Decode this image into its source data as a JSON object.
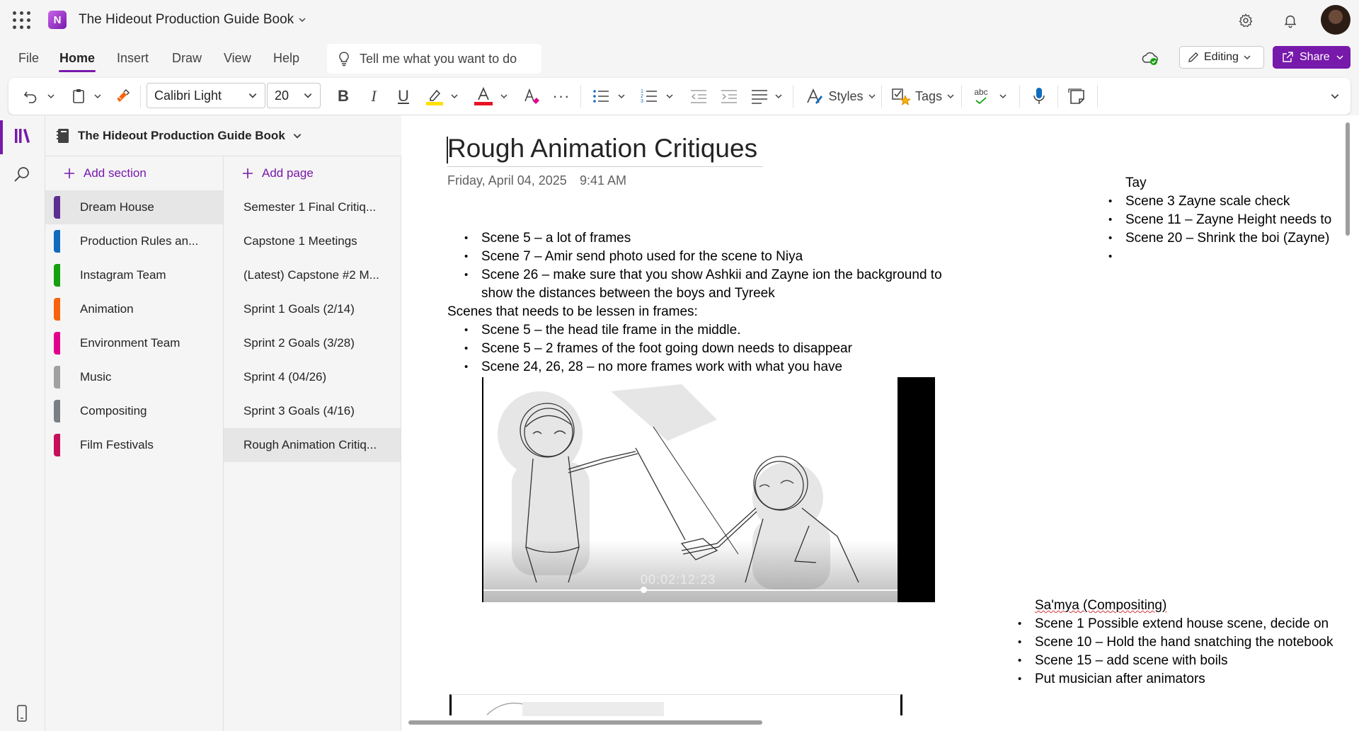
{
  "app": {
    "notebook_title": "The Hideout Production Guide Book",
    "icon_names": [
      "app-launcher-icon",
      "onenote-logo-icon",
      "settings-icon",
      "bell-icon",
      "avatar"
    ]
  },
  "menu": {
    "items": [
      "File",
      "Home",
      "Insert",
      "Draw",
      "View",
      "Help"
    ],
    "active": "Home",
    "tell_me": "Tell me what you want to do",
    "editing_label": "Editing",
    "share_label": "Share"
  },
  "ribbon": {
    "font_name": "Calibri Light",
    "font_size": "20",
    "styles_label": "Styles",
    "tags_label": "Tags",
    "spell_label": "abc"
  },
  "sidebar": {
    "notebook_name": "The Hideout Production Guide Book",
    "add_section_label": "Add section",
    "add_page_label": "Add page",
    "sections": [
      {
        "label": "Dream House",
        "color": "#5c2e91"
      },
      {
        "label": "Production Rules an...",
        "color": "#0f6cbd"
      },
      {
        "label": "Instagram Team",
        "color": "#13a10e"
      },
      {
        "label": "Animation",
        "color": "#f7630c"
      },
      {
        "label": "Environment Team",
        "color": "#e3008c"
      },
      {
        "label": "Music",
        "color": "#a0a0a0"
      },
      {
        "label": "Compositing",
        "color": "#7a7f85"
      },
      {
        "label": "Film Festivals",
        "color": "#c50f5a"
      }
    ],
    "active_section": "Dream House",
    "pages": [
      "Semester 1 Final Critiq...",
      "Capstone 1 Meetings",
      "(Latest) Capstone #2 M...",
      "Sprint 1 Goals (2/14)",
      "Sprint 2 Goals (3/28)",
      "Sprint 4 (04/26)",
      "Sprint 3 Goals (4/16)",
      "Rough Animation Critiq..."
    ],
    "active_page": "Rough Animation Critiq..."
  },
  "page": {
    "title": "Rough Animation Critiques",
    "date": "Friday, April 04, 2025",
    "time": "9:41 AM",
    "main_bullets": [
      "Scene 5 – a lot of frames",
      "Scene 7 – Amir send photo used for the scene to Niya",
      "Scene 26 – make sure that you show Ashkii and Zayne ion the background to show the distances between the boys and Tyreek"
    ],
    "lessen_heading": "Scenes that needs to be lessen in frames:",
    "lessen_bullets": [
      "Scene 5 – the head tile frame in the middle.",
      "Scene 5 – 2 frames of the foot going down needs to disappear",
      "Scene 24, 26, 28 – no more frames work with what you have"
    ],
    "video_timestamp": "00:02:12:23",
    "tay": {
      "heading": "Tay",
      "bullets": [
        "Scene 3 Zayne scale check",
        "Scene 11 – Zayne Height needs to",
        "Scene 20 – Shrink the boi (Zayne)",
        ""
      ]
    },
    "samya": {
      "heading": "Sa'mya (Compositing)",
      "bullets": [
        "Scene 1 Possible extend house scene, decide on",
        "Scene 10 – Hold the hand snatching the notebook",
        "Scene 15 – add scene with boils",
        "Put musician after animators"
      ]
    }
  },
  "colors": {
    "accent": "#7719aa",
    "highlight": "#ffe000",
    "font_color": "#e81123"
  }
}
